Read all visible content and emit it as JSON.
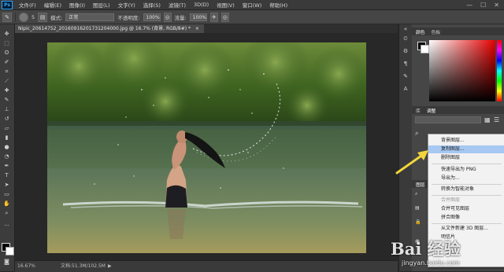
{
  "menubar": {
    "logo": "Ps",
    "items": [
      "文件(F)",
      "编辑(E)",
      "图像(I)",
      "图层(L)",
      "文字(Y)",
      "选择(S)",
      "滤镜(T)",
      "3D(D)",
      "视图(V)",
      "窗口(W)",
      "帮助(H)"
    ],
    "window_controls": [
      "—",
      "☐",
      "✕"
    ]
  },
  "options": {
    "mode_label": "模式:",
    "mode_value": "正常",
    "opacity_label": "不透明度:",
    "opacity_value": "100%",
    "flow_label": "流量:",
    "flow_value": "100%",
    "brush_size": "5"
  },
  "document": {
    "tab_title": "Nipic_20614752_20160916201731204000.jpg @ 16.7% (背景, RGB/8#) *",
    "tab_close": "×"
  },
  "status": {
    "zoom": "16.67%",
    "doc_size": "文档:51.3M/102.5M"
  },
  "panels": {
    "color_tabs": [
      "颜色",
      "色板"
    ],
    "adjust_tabs": [
      "库",
      "调整"
    ],
    "layers_tabs": [
      "图层"
    ]
  },
  "context_menu": {
    "items": [
      {
        "label": "背景图层...",
        "state": "normal"
      },
      {
        "label": "复制图层...",
        "state": "highlighted"
      },
      {
        "label": "删除图层",
        "state": "normal"
      },
      {
        "label": "快速导出为 PNG",
        "state": "normal"
      },
      {
        "label": "导出为...",
        "state": "normal"
      },
      {
        "label": "转换为智能对象",
        "state": "normal"
      },
      {
        "label": "合并图层",
        "state": "disabled"
      },
      {
        "label": "合并可见图层",
        "state": "normal"
      },
      {
        "label": "拼合图像",
        "state": "normal"
      },
      {
        "label": "从文件新建 3D 图层...",
        "state": "normal"
      },
      {
        "label": "明信片",
        "state": "normal"
      }
    ]
  },
  "watermark": {
    "brand": "Bai 经验",
    "url": "jingyan.baidu.com"
  },
  "colors": {
    "annotation_arrow": "#f2d53c",
    "menu_highlight": "#a6c8f2"
  }
}
